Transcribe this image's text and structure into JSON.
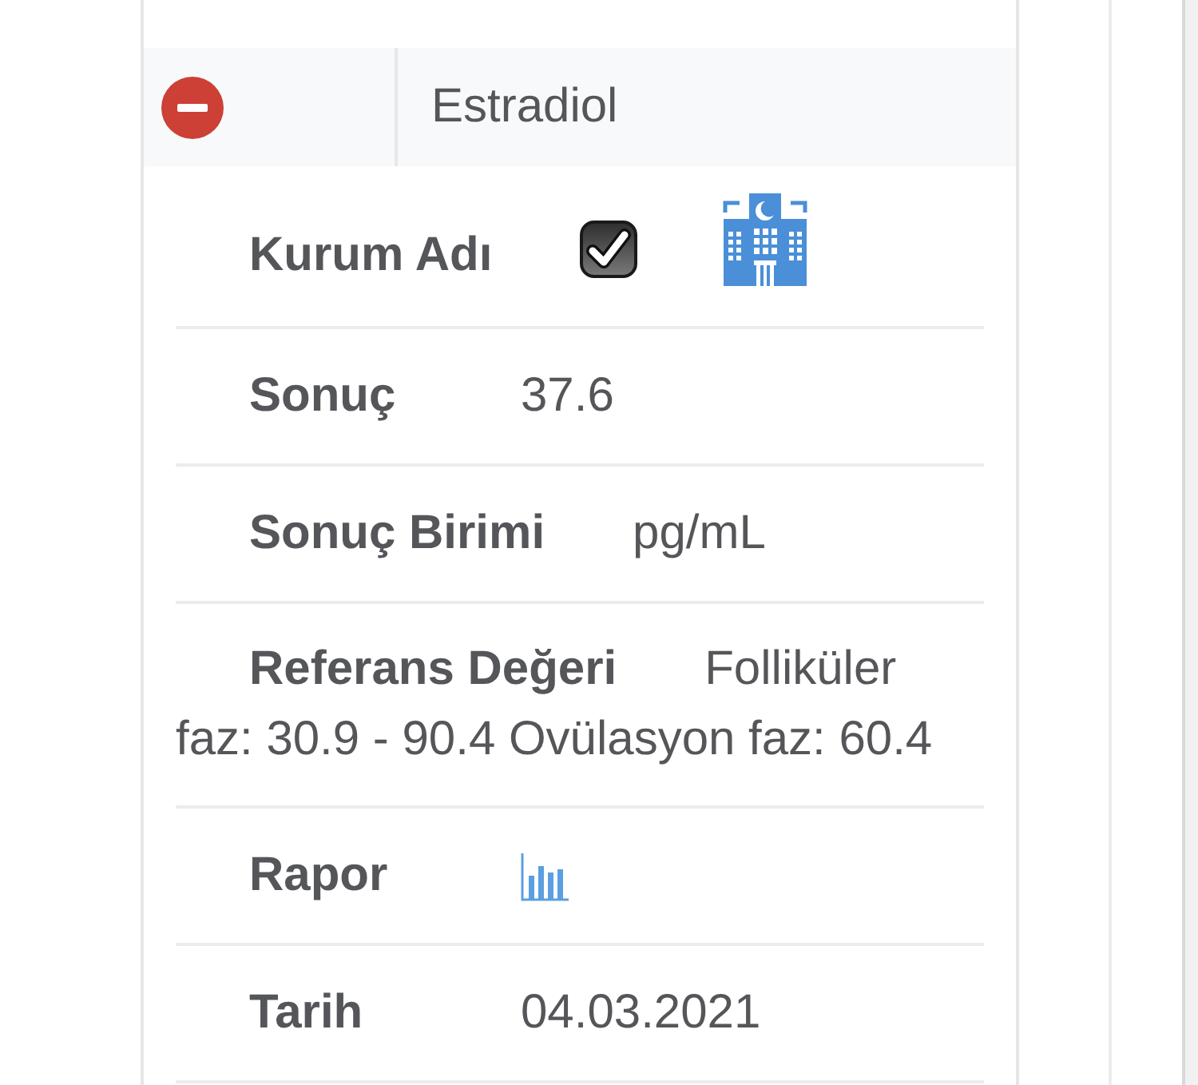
{
  "panel": {
    "title": "Estradiol",
    "expanded": true
  },
  "rows": [
    {
      "kind": "institution",
      "label": "Kurum Adı",
      "checked": true
    },
    {
      "kind": "text",
      "label": "Sonuç",
      "value": "37.6"
    },
    {
      "kind": "text",
      "label": "Sonuç Birimi",
      "value": "pg/mL"
    },
    {
      "kind": "wrapped",
      "label": "Referans Değeri",
      "value_lines": [
        "Folliküler",
        "faz: 30.9 - 90.4 Ovülasyon faz: 60.4"
      ]
    },
    {
      "kind": "report",
      "label": "Rapor"
    },
    {
      "kind": "text",
      "label": "Tarih",
      "value": "04.03.2021"
    }
  ]
}
